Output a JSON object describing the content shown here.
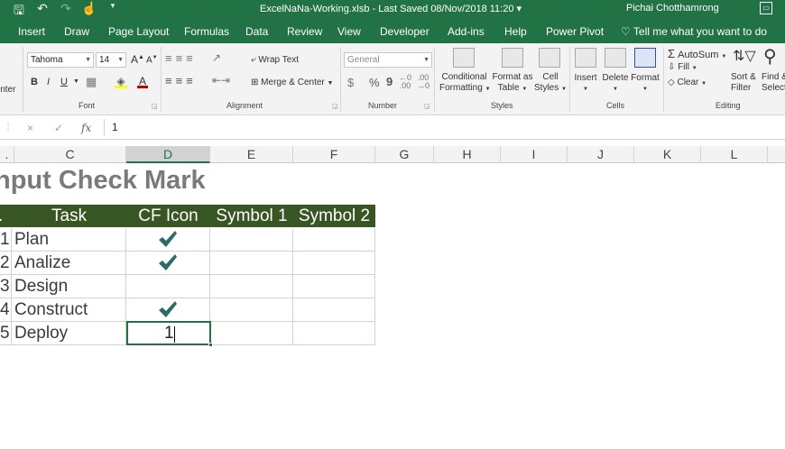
{
  "title_bar": {
    "qat_icons": [
      "save-icon",
      "undo-icon",
      "redo-icon",
      "touch-mode-icon",
      "customize-qat-icon"
    ],
    "document_title": "ExcelNaNa-Working.xlsb  -  Last Saved 08/Nov/2018 11:20",
    "title_dropdown": "▾",
    "user_name": "Pichai Chotthamrong"
  },
  "ribbon_tabs": [
    "Insert",
    "Draw",
    "Page Layout",
    "Formulas",
    "Data",
    "Review",
    "View",
    "Developer",
    "Add-ins",
    "Help",
    "Power Pivot"
  ],
  "tell_me": "Tell me what you want to do",
  "clipboard": {
    "format_painter_label": "inter"
  },
  "font_group": {
    "label": "Font",
    "font_name": "Tahoma",
    "font_size": "14",
    "bold": "B",
    "italic": "I",
    "underline": "U",
    "grow": "A",
    "shrink": "A",
    "font_color": "#c00000",
    "fill_color": "#ffff00"
  },
  "alignment_group": {
    "label": "Alignment",
    "wrap_text": "Wrap Text",
    "merge_center": "Merge & Center"
  },
  "number_group": {
    "label": "Number",
    "format": "General",
    "currency": "$",
    "percent": "%",
    "comma": "9"
  },
  "styles_group": {
    "label": "Styles",
    "conditional_formatting": [
      "Conditional",
      "Formatting"
    ],
    "format_as_table": [
      "Format as",
      "Table"
    ],
    "cell_styles": [
      "Cell",
      "Styles"
    ]
  },
  "cells_group": {
    "label": "Cells",
    "insert": "Insert",
    "delete": "Delete",
    "format": "Format"
  },
  "editing_group": {
    "label": "Editing",
    "autosum": "AutoSum",
    "fill": "Fill",
    "clear": "Clear",
    "sort_filter": [
      "Sort &",
      "Filter"
    ],
    "find_select": [
      "Find &",
      "Select"
    ]
  },
  "formula_bar": {
    "cancel": "×",
    "enter": "✓",
    "fx": "fx",
    "value": "1"
  },
  "column_headers": [
    ".",
    "C",
    "D",
    "E",
    "F",
    "G",
    "H",
    "I",
    "J",
    "K",
    "L"
  ],
  "sheet": {
    "title": "nput Check Mark",
    "headers": [
      ".",
      "Task",
      "CF Icon",
      "Symbol 1",
      "Symbol 2"
    ],
    "rows": [
      {
        "no": "1",
        "task": "Plan",
        "checked": true
      },
      {
        "no": "2",
        "task": "Analize",
        "checked": true
      },
      {
        "no": "3",
        "task": "Design",
        "checked": false
      },
      {
        "no": "4",
        "task": "Construct",
        "checked": true
      },
      {
        "no": "5",
        "task": "Deploy",
        "checked": false
      }
    ],
    "active_cell_value": "1",
    "accent_green": "#375623",
    "check_color": "#2e6b66"
  }
}
